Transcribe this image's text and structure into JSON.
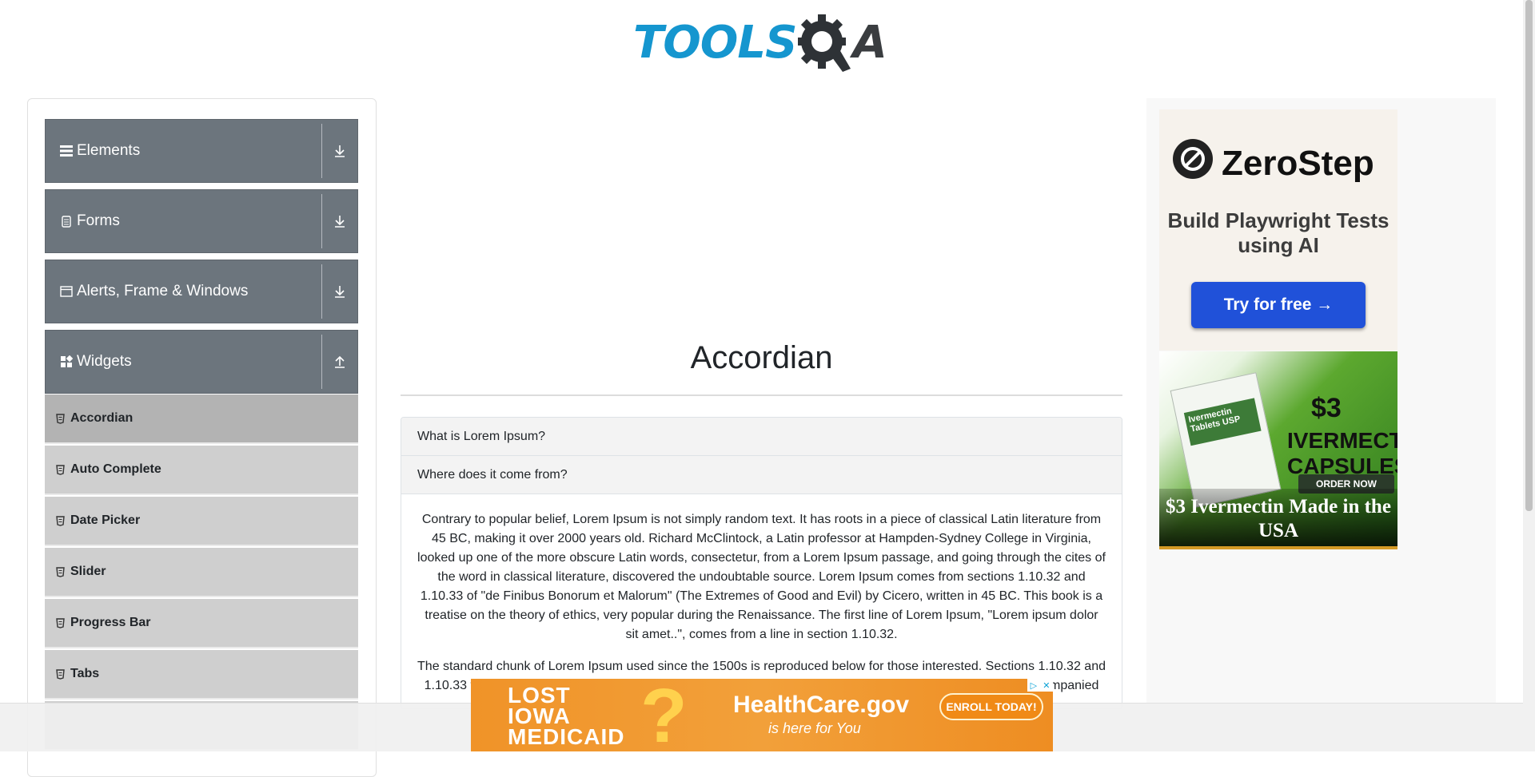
{
  "logo": {
    "part1": "TOOLS",
    "part2": "A"
  },
  "sidebar": {
    "groups": [
      {
        "label": "Elements",
        "icon": "hamburger-icon"
      },
      {
        "label": "Forms",
        "icon": "file-icon"
      },
      {
        "label": "Alerts, Frame & Windows",
        "icon": "window-icon"
      },
      {
        "label": "Widgets",
        "icon": "widgets-icon"
      }
    ],
    "widget_items": [
      {
        "label": "Accordian",
        "active": true
      },
      {
        "label": "Auto Complete"
      },
      {
        "label": "Date Picker"
      },
      {
        "label": "Slider"
      },
      {
        "label": "Progress Bar"
      },
      {
        "label": "Tabs"
      }
    ]
  },
  "main": {
    "title": "Accordian",
    "sections": [
      {
        "heading": "What is Lorem Ipsum?"
      },
      {
        "heading": "Where does it come from?"
      }
    ],
    "paragraph1": "Contrary to popular belief, Lorem Ipsum is not simply random text. It has roots in a piece of classical Latin literature from 45 BC, making it over 2000 years old. Richard McClintock, a Latin professor at Hampden-Sydney College in Virginia, looked up one of the more obscure Latin words, consectetur, from a Lorem Ipsum passage, and going through the cites of the word in classical literature, discovered the undoubtable source. Lorem Ipsum comes from sections 1.10.32 and 1.10.33 of \"de Finibus Bonorum et Malorum\" (The Extremes of Good and Evil) by Cicero, written in 45 BC. This book is a treatise on the theory of ethics, very popular during the Renaissance. The first line of Lorem Ipsum, \"Lorem ipsum dolor sit amet..\", comes from a line in section 1.10.32.",
    "paragraph2": "The standard chunk of Lorem Ipsum used since the 1500s is reproduced below for those interested. Sections 1.10.32 and 1.10.33 from \"de Finibus Bonorum et Malorum\" by Cicero are also reproduced in their exact original form, accompanied"
  },
  "ads": {
    "zerostep": {
      "brand": "ZeroStep",
      "tagline": "Build Playwright Tests using AI",
      "button": "Try for free →"
    },
    "ivermectin": {
      "box_label": "Ivermectin Tablets USP",
      "price": "$3",
      "name": "IVERMECTIN CAPSULES",
      "order": "ORDER NOW",
      "caption": "$3 Ivermectin Made in the USA"
    },
    "bottom": {
      "line1": "LOST",
      "line2": "IOWA",
      "line3": "MEDICAID",
      "site": "HealthCare.gov",
      "tag": "is here for You",
      "button": "ENROLL TODAY!"
    }
  },
  "colors": {
    "sidebar_group": "#6c757d",
    "sidebar_item": "#cfcfcf",
    "logo_blue": "#1596cf",
    "zerostep_button": "#2051d9"
  }
}
